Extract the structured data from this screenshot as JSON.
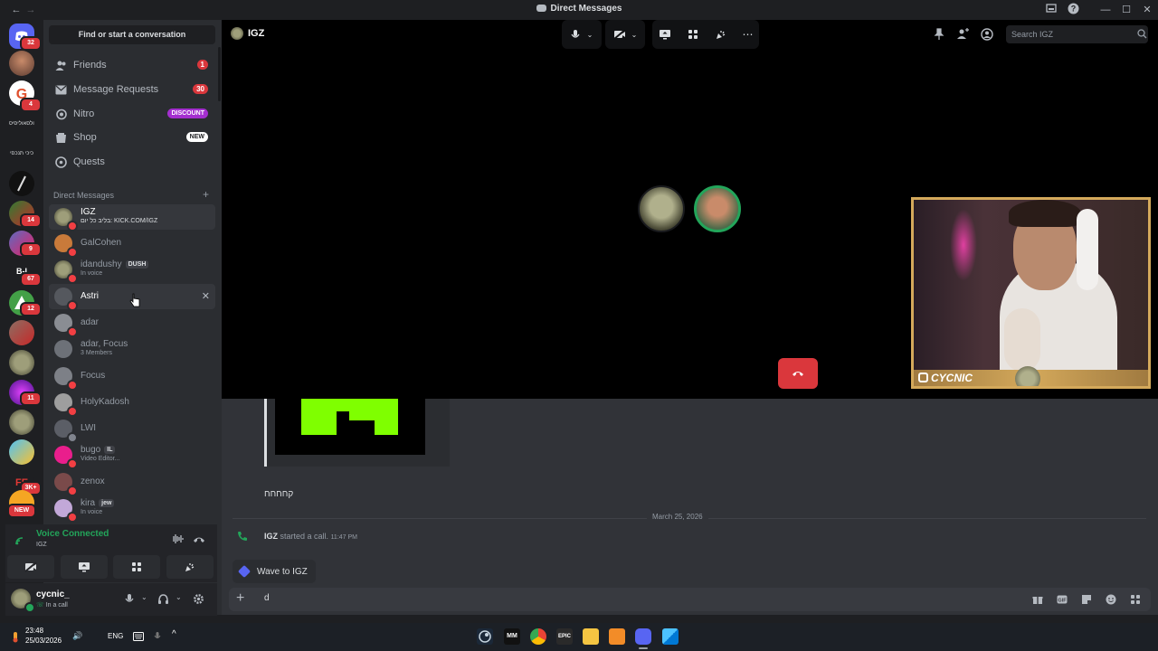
{
  "window": {
    "title": "Direct Messages"
  },
  "servers": {
    "badges": [
      {
        "label": "32"
      },
      {
        "label": "4"
      },
      {
        "label": "14"
      },
      {
        "label": "9"
      },
      {
        "label": "67"
      },
      {
        "label": "12"
      },
      {
        "label": "11"
      },
      {
        "label": "3K+"
      },
      {
        "label": "NEW"
      }
    ],
    "texts": {
      "s3": "רולסאוליסיס",
      "s4": "כיכי תנכסי",
      "s7": "B-I"
    }
  },
  "sidebar": {
    "find_placeholder": "Find or start a conversation",
    "nav": [
      {
        "label": "Friends",
        "badge": "1"
      },
      {
        "label": "Message Requests",
        "badge": "30"
      },
      {
        "label": "Nitro",
        "badge": "DISCOUNT"
      },
      {
        "label": "Shop",
        "badge": "NEW"
      },
      {
        "label": "Quests",
        "badge": ""
      }
    ],
    "dm_header": "Direct Messages",
    "dms": [
      {
        "name": "IGZ",
        "sub": "בליב כל יום: KICK.COM/IGZ",
        "tag": ""
      },
      {
        "name": "GalCohen",
        "sub": "",
        "tag": ""
      },
      {
        "name": "idandushy",
        "sub": "In voice",
        "tag": "DUSH"
      },
      {
        "name": "Astri",
        "sub": "",
        "tag": ""
      },
      {
        "name": "adar",
        "sub": "",
        "tag": ""
      },
      {
        "name": "adar, Focus",
        "sub": "3 Members",
        "tag": ""
      },
      {
        "name": "Focus",
        "sub": "",
        "tag": ""
      },
      {
        "name": "HolyKadosh",
        "sub": "",
        "tag": ""
      },
      {
        "name": "LWI",
        "sub": "",
        "tag": ""
      },
      {
        "name": "bugo",
        "sub": "Video Editor...",
        "tag": "IL"
      },
      {
        "name": "zenox",
        "sub": "",
        "tag": ""
      },
      {
        "name": "kira",
        "sub": "In voice",
        "tag": "jew"
      }
    ]
  },
  "voice": {
    "status": "Voice Connected",
    "channel": "IGZ"
  },
  "user": {
    "name": "cycnic_",
    "status": "In a call"
  },
  "chat": {
    "channel_name": "IGZ",
    "search_placeholder": "Search IGZ",
    "attachment_caption": "קחחחח",
    "date_divider": "March 25, 2026",
    "call_message": {
      "user": "IGZ",
      "text": "started a call.",
      "time": "11:47 PM"
    },
    "wave_button": "Wave to IGZ",
    "composer_value": "d"
  },
  "stream": {
    "overlay_text": "CYCNIC"
  },
  "taskbar": {
    "time": "23:48",
    "date": "25/03/2026",
    "lang": "ENG"
  },
  "colors": {
    "accent": "#5865f2",
    "danger": "#da373c",
    "voice_green": "#23a55a",
    "nitro": "#a42fcf",
    "stream_border": "#d4a95b"
  }
}
